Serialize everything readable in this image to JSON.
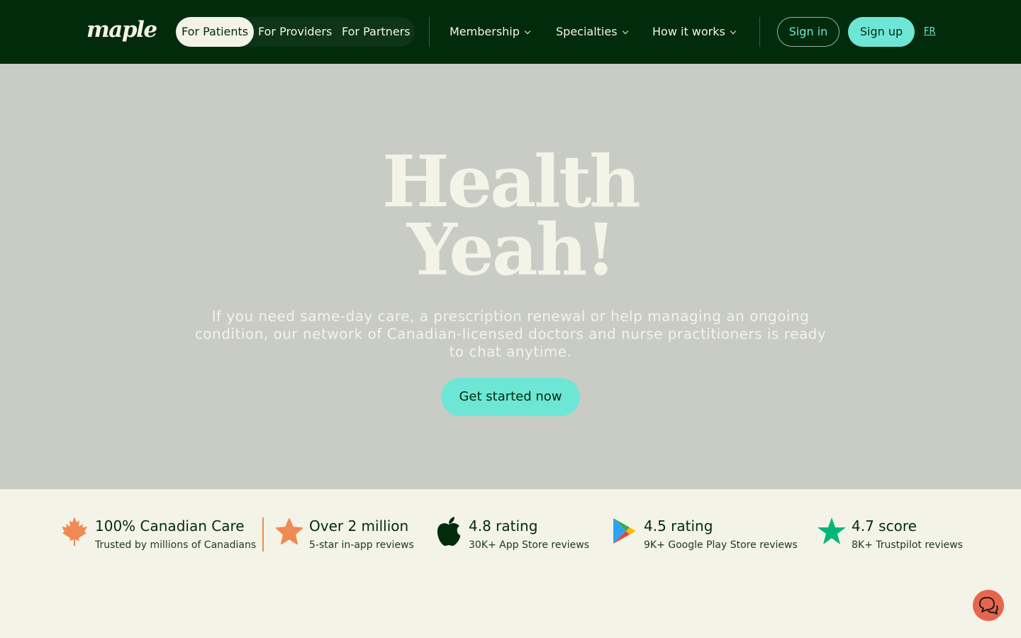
{
  "nav": {
    "logo": "maple",
    "audience_tabs": [
      {
        "label": "For Patients",
        "active": true
      },
      {
        "label": "For Providers",
        "active": false
      },
      {
        "label": "For Partners",
        "active": false
      }
    ],
    "menus": [
      {
        "label": "Membership",
        "icon": "chevron-down-icon"
      },
      {
        "label": "Specialties",
        "icon": "chevron-down-icon"
      },
      {
        "label": "How it works",
        "icon": "chevron-down-icon"
      }
    ],
    "sign_in": "Sign in",
    "sign_up": "Sign up",
    "language": "FR"
  },
  "hero": {
    "headline_line1": "Health",
    "headline_line2": "Yeah!",
    "subtext": "If you need same-day care, a prescription renewal or help managing an ongoing condition, our network of Canadian-licensed doctors and nurse practitioners is ready to chat anytime.",
    "cta": "Get started now"
  },
  "stats": [
    {
      "icon": "maple-leaf-icon",
      "title": "100% Canadian Care",
      "subtitle": "Trusted by millions of Canadians"
    },
    {
      "icon": "star-icon",
      "title": "Over 2 million",
      "subtitle": "5-star in-app reviews"
    },
    {
      "icon": "apple-icon",
      "title": "4.8 rating",
      "subtitle": "30K+ App Store reviews"
    },
    {
      "icon": "google-play-icon",
      "title": "4.5 rating",
      "subtitle": "9K+ Google Play Store reviews"
    },
    {
      "icon": "trustpilot-star-icon",
      "title": "4.7 score",
      "subtitle": "8K+ Trustpilot reviews"
    }
  ],
  "chat_widget": {
    "icon": "chat-bubbles-icon"
  },
  "colors": {
    "nav_bg": "#022b0c",
    "accent": "#6ee6d6",
    "hero_bg": "#c9ccc5",
    "cream": "#f3f3e7",
    "orange": "#ef8a55",
    "chat": "#e8654d"
  }
}
